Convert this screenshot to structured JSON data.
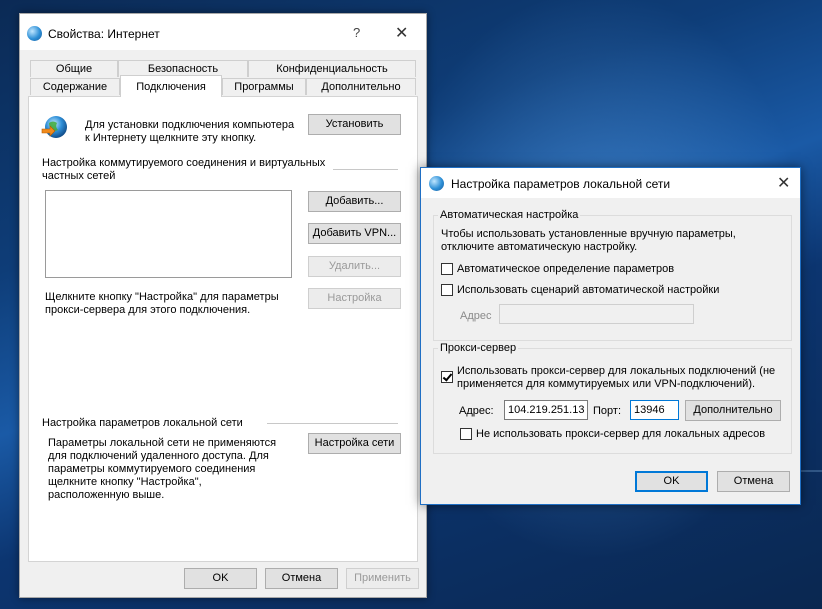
{
  "main_dialog": {
    "title": "Свойства: Интернет",
    "help": "?",
    "close": "✕",
    "tabs_row1": [
      "Общие",
      "Безопасность",
      "Конфиденциальность"
    ],
    "tabs_row2": [
      "Содержание",
      "Подключения",
      "Программы",
      "Дополнительно"
    ],
    "active_tab": "Подключения",
    "setup_text_1": "Для установки подключения компьютера",
    "setup_text_2": "к Интернету щелкните эту кнопку.",
    "setup_button": "Установить",
    "dialup_header_1": "Настройка коммутируемого соединения и виртуальных",
    "dialup_header_2": "частных сетей",
    "add_button": "Добавить...",
    "add_vpn_button": "Добавить VPN...",
    "remove_button": "Удалить...",
    "proxy_text_1": "Щелкните кнопку \"Настройка\" для параметры",
    "proxy_text_2": "прокси-сервера для этого подключения.",
    "settings_button": "Настройка",
    "lan_header": "Настройка параметров локальной сети",
    "lan_text_1": "Параметры локальной сети не применяются",
    "lan_text_2": "для подключений удаленного доступа. Для",
    "lan_text_3": "параметры коммутируемого соединения",
    "lan_text_4": "щелкните кнопку \"Настройка\",",
    "lan_text_5": "расположенную выше.",
    "lan_settings_button": "Настройка сети",
    "ok": "OK",
    "cancel": "Отмена",
    "apply": "Применить"
  },
  "lan_dialog": {
    "title": "Настройка параметров локальной сети",
    "close": "✕",
    "auto_group": "Автоматическая настройка",
    "auto_text_1": "Чтобы использовать установленные вручную параметры,",
    "auto_text_2": "отключите автоматическую настройку.",
    "auto_detect": "Автоматическое определение параметров",
    "auto_detect_checked": false,
    "auto_script": "Использовать сценарий автоматической настройки",
    "auto_script_checked": false,
    "address_label": "Адрес",
    "address_value": "",
    "proxy_group": "Прокси-сервер",
    "use_proxy_1": "Использовать прокси-сервер для локальных подключений (не",
    "use_proxy_2": "применяется для коммутируемых или VPN-подключений).",
    "use_proxy_checked": true,
    "proxy_address_label": "Адрес:",
    "proxy_address_value": "104.219.251.13",
    "port_label": "Порт:",
    "port_value": "13946",
    "advanced_button": "Дополнительно",
    "bypass_local": "Не использовать прокси-сервер для локальных адресов",
    "bypass_local_checked": false,
    "ok": "OK",
    "cancel": "Отмена"
  }
}
